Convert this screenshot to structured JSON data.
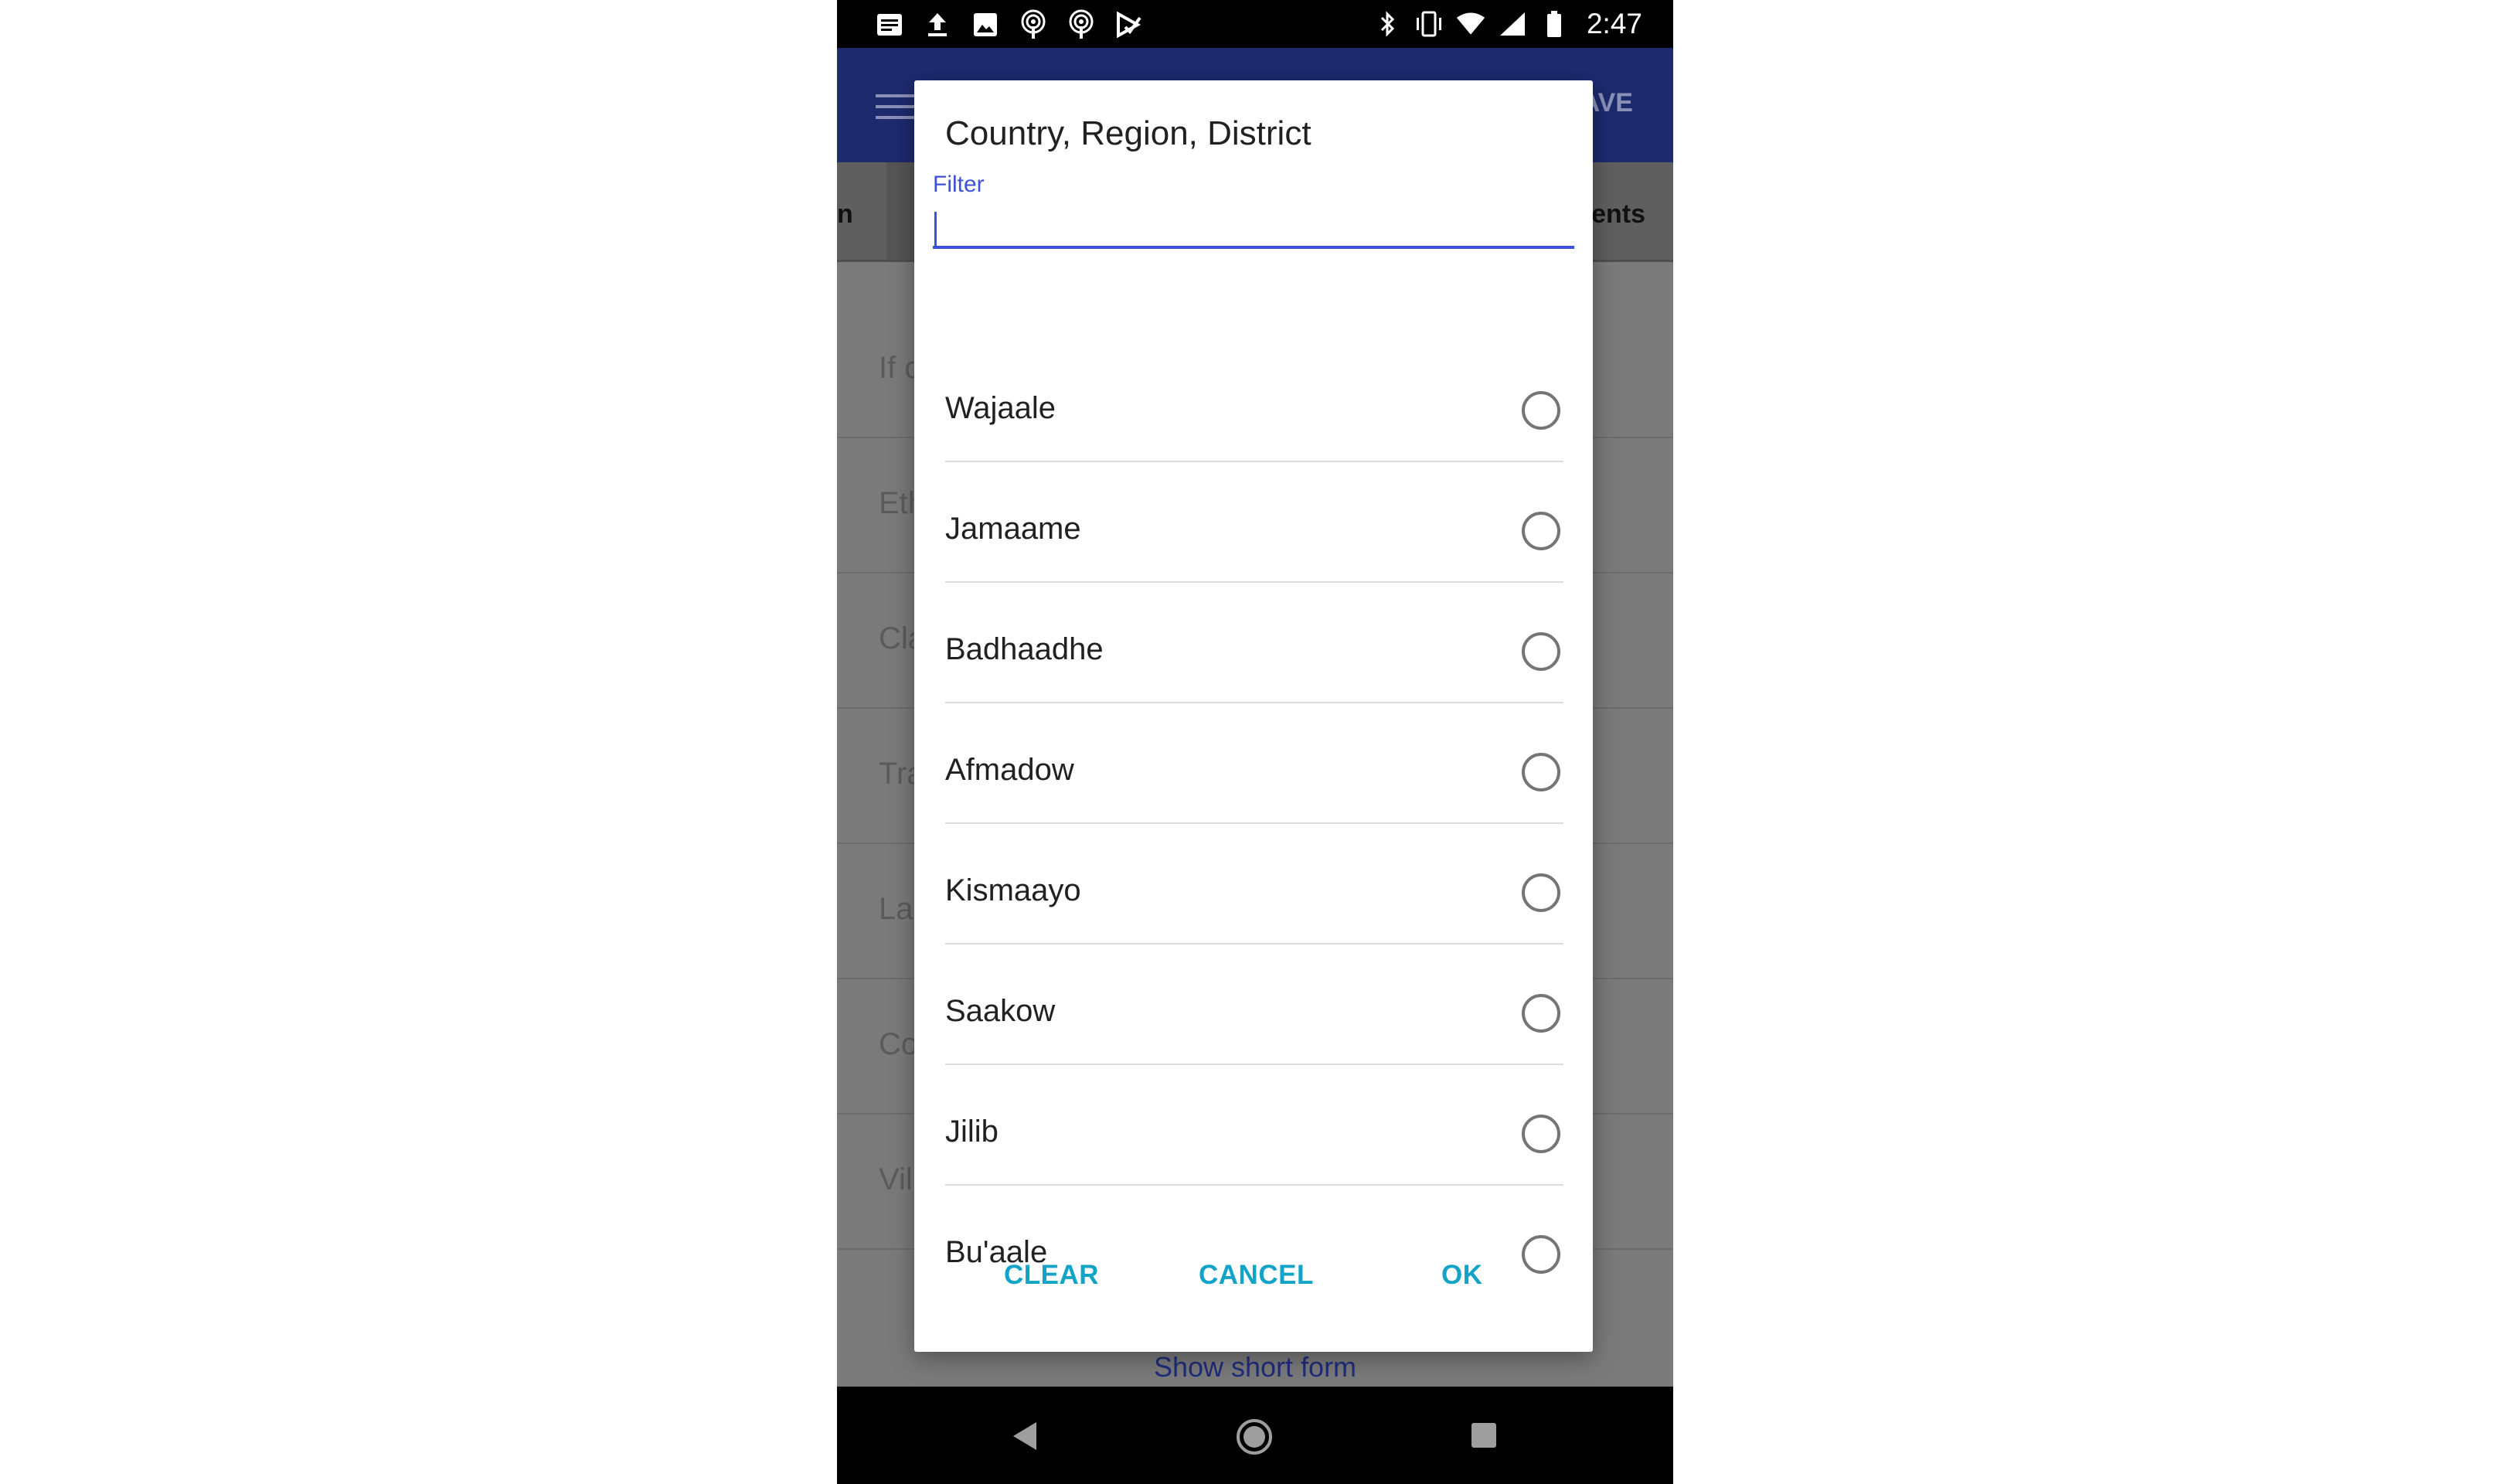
{
  "status_bar": {
    "time": "2:47"
  },
  "app_bar": {
    "save_label": "SAVE"
  },
  "tabs": {
    "left_fragment": "n",
    "right_fragment": "ents"
  },
  "background_rows": [
    "If c",
    "Eth",
    "Cla",
    "Tra",
    "La",
    "Co",
    "Vil"
  ],
  "background_bottom_link": "Show short form",
  "dialog": {
    "title": "Country, Region, District",
    "filter_label": "Filter",
    "filter_value": "",
    "items": [
      {
        "label": "Wajaale",
        "selected": false
      },
      {
        "label": "Jamaame",
        "selected": false
      },
      {
        "label": "Badhaadhe",
        "selected": false
      },
      {
        "label": "Afmadow",
        "selected": false
      },
      {
        "label": "Kismaayo",
        "selected": false
      },
      {
        "label": "Saakow",
        "selected": false
      },
      {
        "label": "Jilib",
        "selected": false
      },
      {
        "label": "Bu'aale",
        "selected": false
      }
    ],
    "buttons": {
      "clear": "CLEAR",
      "cancel": "CANCEL",
      "ok": "OK"
    }
  },
  "colors": {
    "accent": "#3f51d8",
    "button_text": "#12a4c8",
    "app_bar": "#1d2a6e"
  }
}
